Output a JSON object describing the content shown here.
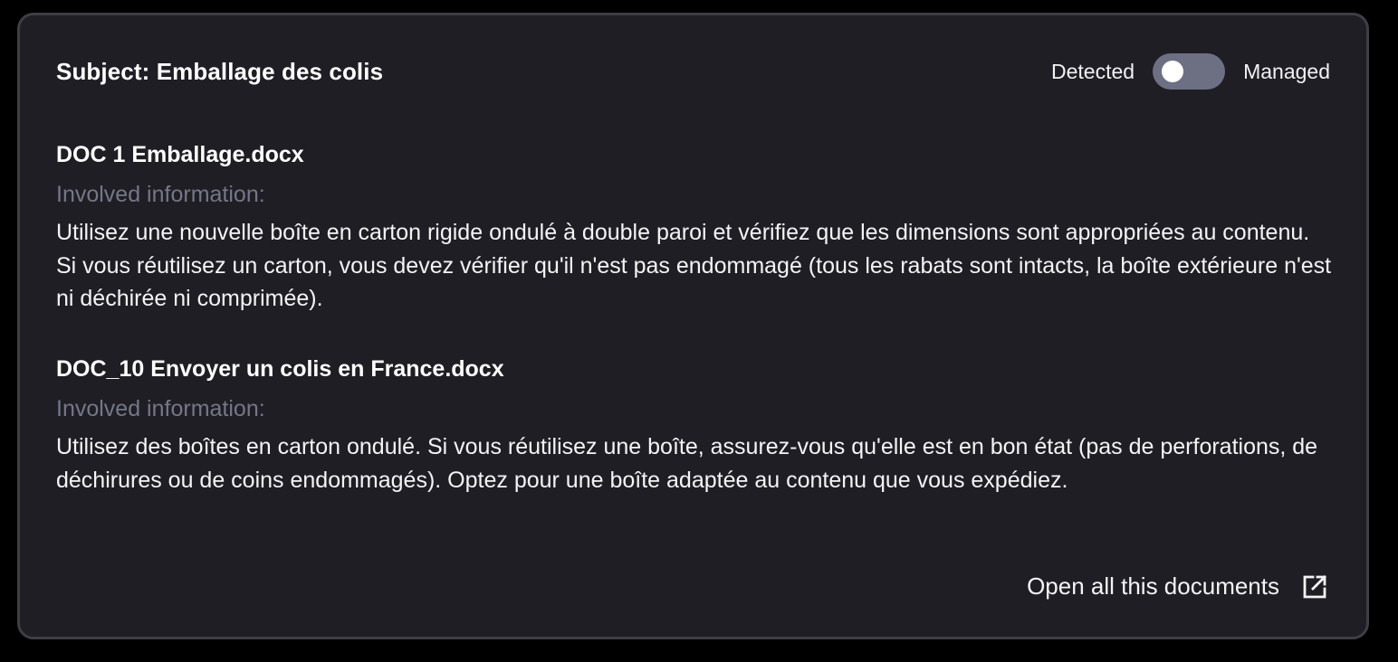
{
  "header": {
    "subject": "Subject: Emballage des colis",
    "toggle_left_label": "Detected",
    "toggle_right_label": "Managed",
    "toggle_state": "Detected"
  },
  "documents": [
    {
      "title": "DOC 1 Emballage.docx",
      "involved_label": "Involved information:",
      "text": "Utilisez une nouvelle boîte en carton rigide ondulé à double paroi et vérifiez que les dimensions sont appropriées au contenu. Si vous réutilisez un carton, vous devez vérifier qu'il n'est pas endommagé (tous les rabats sont intacts, la boîte extérieure n'est ni déchirée ni comprimée)."
    },
    {
      "title": "DOC_10 Envoyer un colis en France.docx",
      "involved_label": "Involved information:",
      "text": "Utilisez des boîtes en carton ondulé. Si vous réutilisez une boîte, assurez-vous qu'elle est en bon état (pas de perforations, de déchirures ou de coins endommagés). Optez pour une boîte adaptée au contenu que vous expédiez."
    }
  ],
  "footer": {
    "open_all_label": "Open all this documents",
    "open_icon": "external-link-icon"
  },
  "colors": {
    "background": "#000000",
    "card": "#1f1e24",
    "card_border": "#3e3e45",
    "toggle_track": "#6d6f83",
    "muted_text": "#757788",
    "text": "#ffffff"
  }
}
